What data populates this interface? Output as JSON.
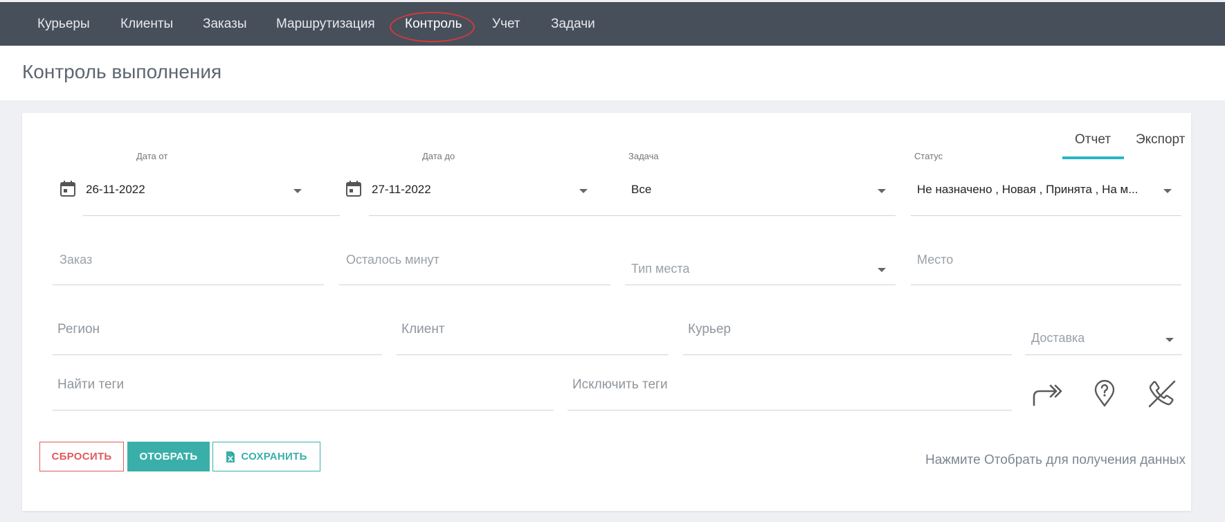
{
  "nav": {
    "items": [
      {
        "label": "Курьеры"
      },
      {
        "label": "Клиенты"
      },
      {
        "label": "Заказы"
      },
      {
        "label": "Маршрутизация"
      },
      {
        "label": "Контроль"
      },
      {
        "label": "Учет"
      },
      {
        "label": "Задачи"
      }
    ],
    "active": "Контроль"
  },
  "page": {
    "title": "Контроль выполнения"
  },
  "tabs": [
    {
      "label": "Отчет",
      "active": true
    },
    {
      "label": "Экспорт",
      "active": false
    }
  ],
  "filters": {
    "date_from": {
      "label": "Дата от",
      "value": "26-11-2022"
    },
    "date_to": {
      "label": "Дата до",
      "value": "27-11-2022"
    },
    "task": {
      "label": "Задача",
      "value": "Все"
    },
    "status": {
      "label": "Статус",
      "value": "Не назначено , Новая , Принята , На м..."
    },
    "order": {
      "placeholder": "Заказ"
    },
    "minutes_left": {
      "placeholder": "Осталось минут"
    },
    "place_type": {
      "placeholder": "Тип места"
    },
    "place": {
      "placeholder": "Место"
    },
    "region": {
      "placeholder": "Регион"
    },
    "client": {
      "placeholder": "Клиент"
    },
    "courier": {
      "placeholder": "Курьер"
    },
    "delivery": {
      "placeholder": "Доставка"
    },
    "find_tags": {
      "placeholder": "Найти теги"
    },
    "exclude_tags": {
      "placeholder": "Исключить теги"
    }
  },
  "action_icons": [
    "forward-arrows-icon",
    "map-pin-question-icon",
    "phone-off-icon"
  ],
  "buttons": {
    "reset": "СБРОСИТЬ",
    "show": "ОТОБРАТЬ",
    "save": "СОХРАНИТЬ"
  },
  "hint": "Нажмите Отобрать для получения данных",
  "colors": {
    "nav_bg": "#474f5b",
    "accent": "#3aafa9",
    "tab_underline": "#29b6c8",
    "danger": "#e05a5a",
    "highlight_circle": "#d33a3a"
  }
}
